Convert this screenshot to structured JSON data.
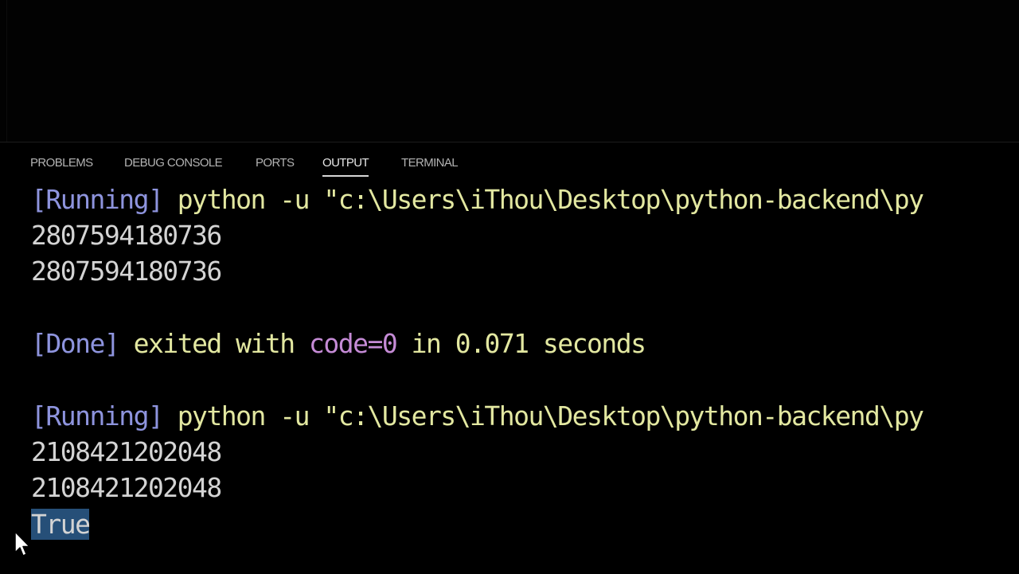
{
  "panel": {
    "tabs": [
      {
        "label": "PROBLEMS",
        "active": false
      },
      {
        "label": "DEBUG CONSOLE",
        "active": false
      },
      {
        "label": "PORTS",
        "active": false
      },
      {
        "label": "OUTPUT",
        "active": true
      },
      {
        "label": "TERMINAL",
        "active": false
      }
    ]
  },
  "output": {
    "run1": {
      "tag": "[Running]",
      "command": "python -u \"c:\\Users\\iThou\\Desktop\\python-backend\\py",
      "lines": [
        "2807594180736",
        "2807594180736"
      ]
    },
    "done": {
      "tag": "[Done]",
      "text1": "exited with",
      "code": "code=0",
      "text2": "in 0.071 seconds"
    },
    "run2": {
      "tag": "[Running]",
      "command": "python -u \"c:\\Users\\iThou\\Desktop\\python-backend\\py",
      "lines": [
        "2108421202048",
        "2108421202048"
      ],
      "result": "True"
    }
  },
  "colors": {
    "background": "#000000",
    "tag": "#8e94de",
    "command": "#e3e8a1",
    "code": "#c58bd6",
    "selection": "#264f78"
  }
}
